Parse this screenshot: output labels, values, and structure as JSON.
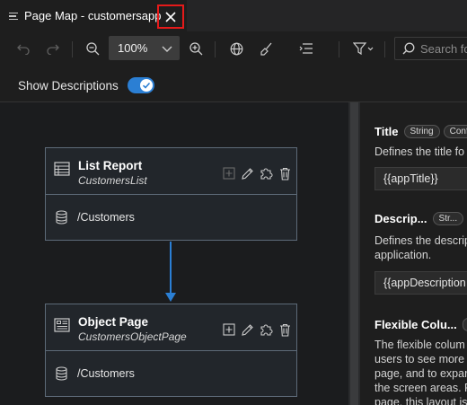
{
  "tab": {
    "title": "Page Map - customersapp"
  },
  "toolbar": {
    "zoom_value": "100%",
    "search_placeholder": "Search fo"
  },
  "show_descriptions": {
    "label": "Show Descriptions",
    "enabled": true
  },
  "nodes": [
    {
      "title": "List Report",
      "subtitle": "CustomersList",
      "entity": "/Customers"
    },
    {
      "title": "Object Page",
      "subtitle": "CustomersObjectPage",
      "entity": "/Customers"
    }
  ],
  "properties": [
    {
      "title": "Title",
      "badges": [
        "String",
        "Conf"
      ],
      "description": "Defines the title fo",
      "value": "{{appTitle}}"
    },
    {
      "title": "Descrip...",
      "badges": [
        "Str..."
      ],
      "description_lines": [
        "Defines the descrip",
        "application."
      ],
      "value": "{{appDescription"
    },
    {
      "title": "Flexible Colu...",
      "badges": [],
      "description_lines": [
        "The flexible colum",
        "users to see more",
        "page, and to expar",
        "the screen areas. F",
        "page, this layout is"
      ]
    }
  ],
  "colors": {
    "accent": "#2b7fd4",
    "close_highlight": "#e51a1a",
    "node_border": "#5d6a78"
  }
}
